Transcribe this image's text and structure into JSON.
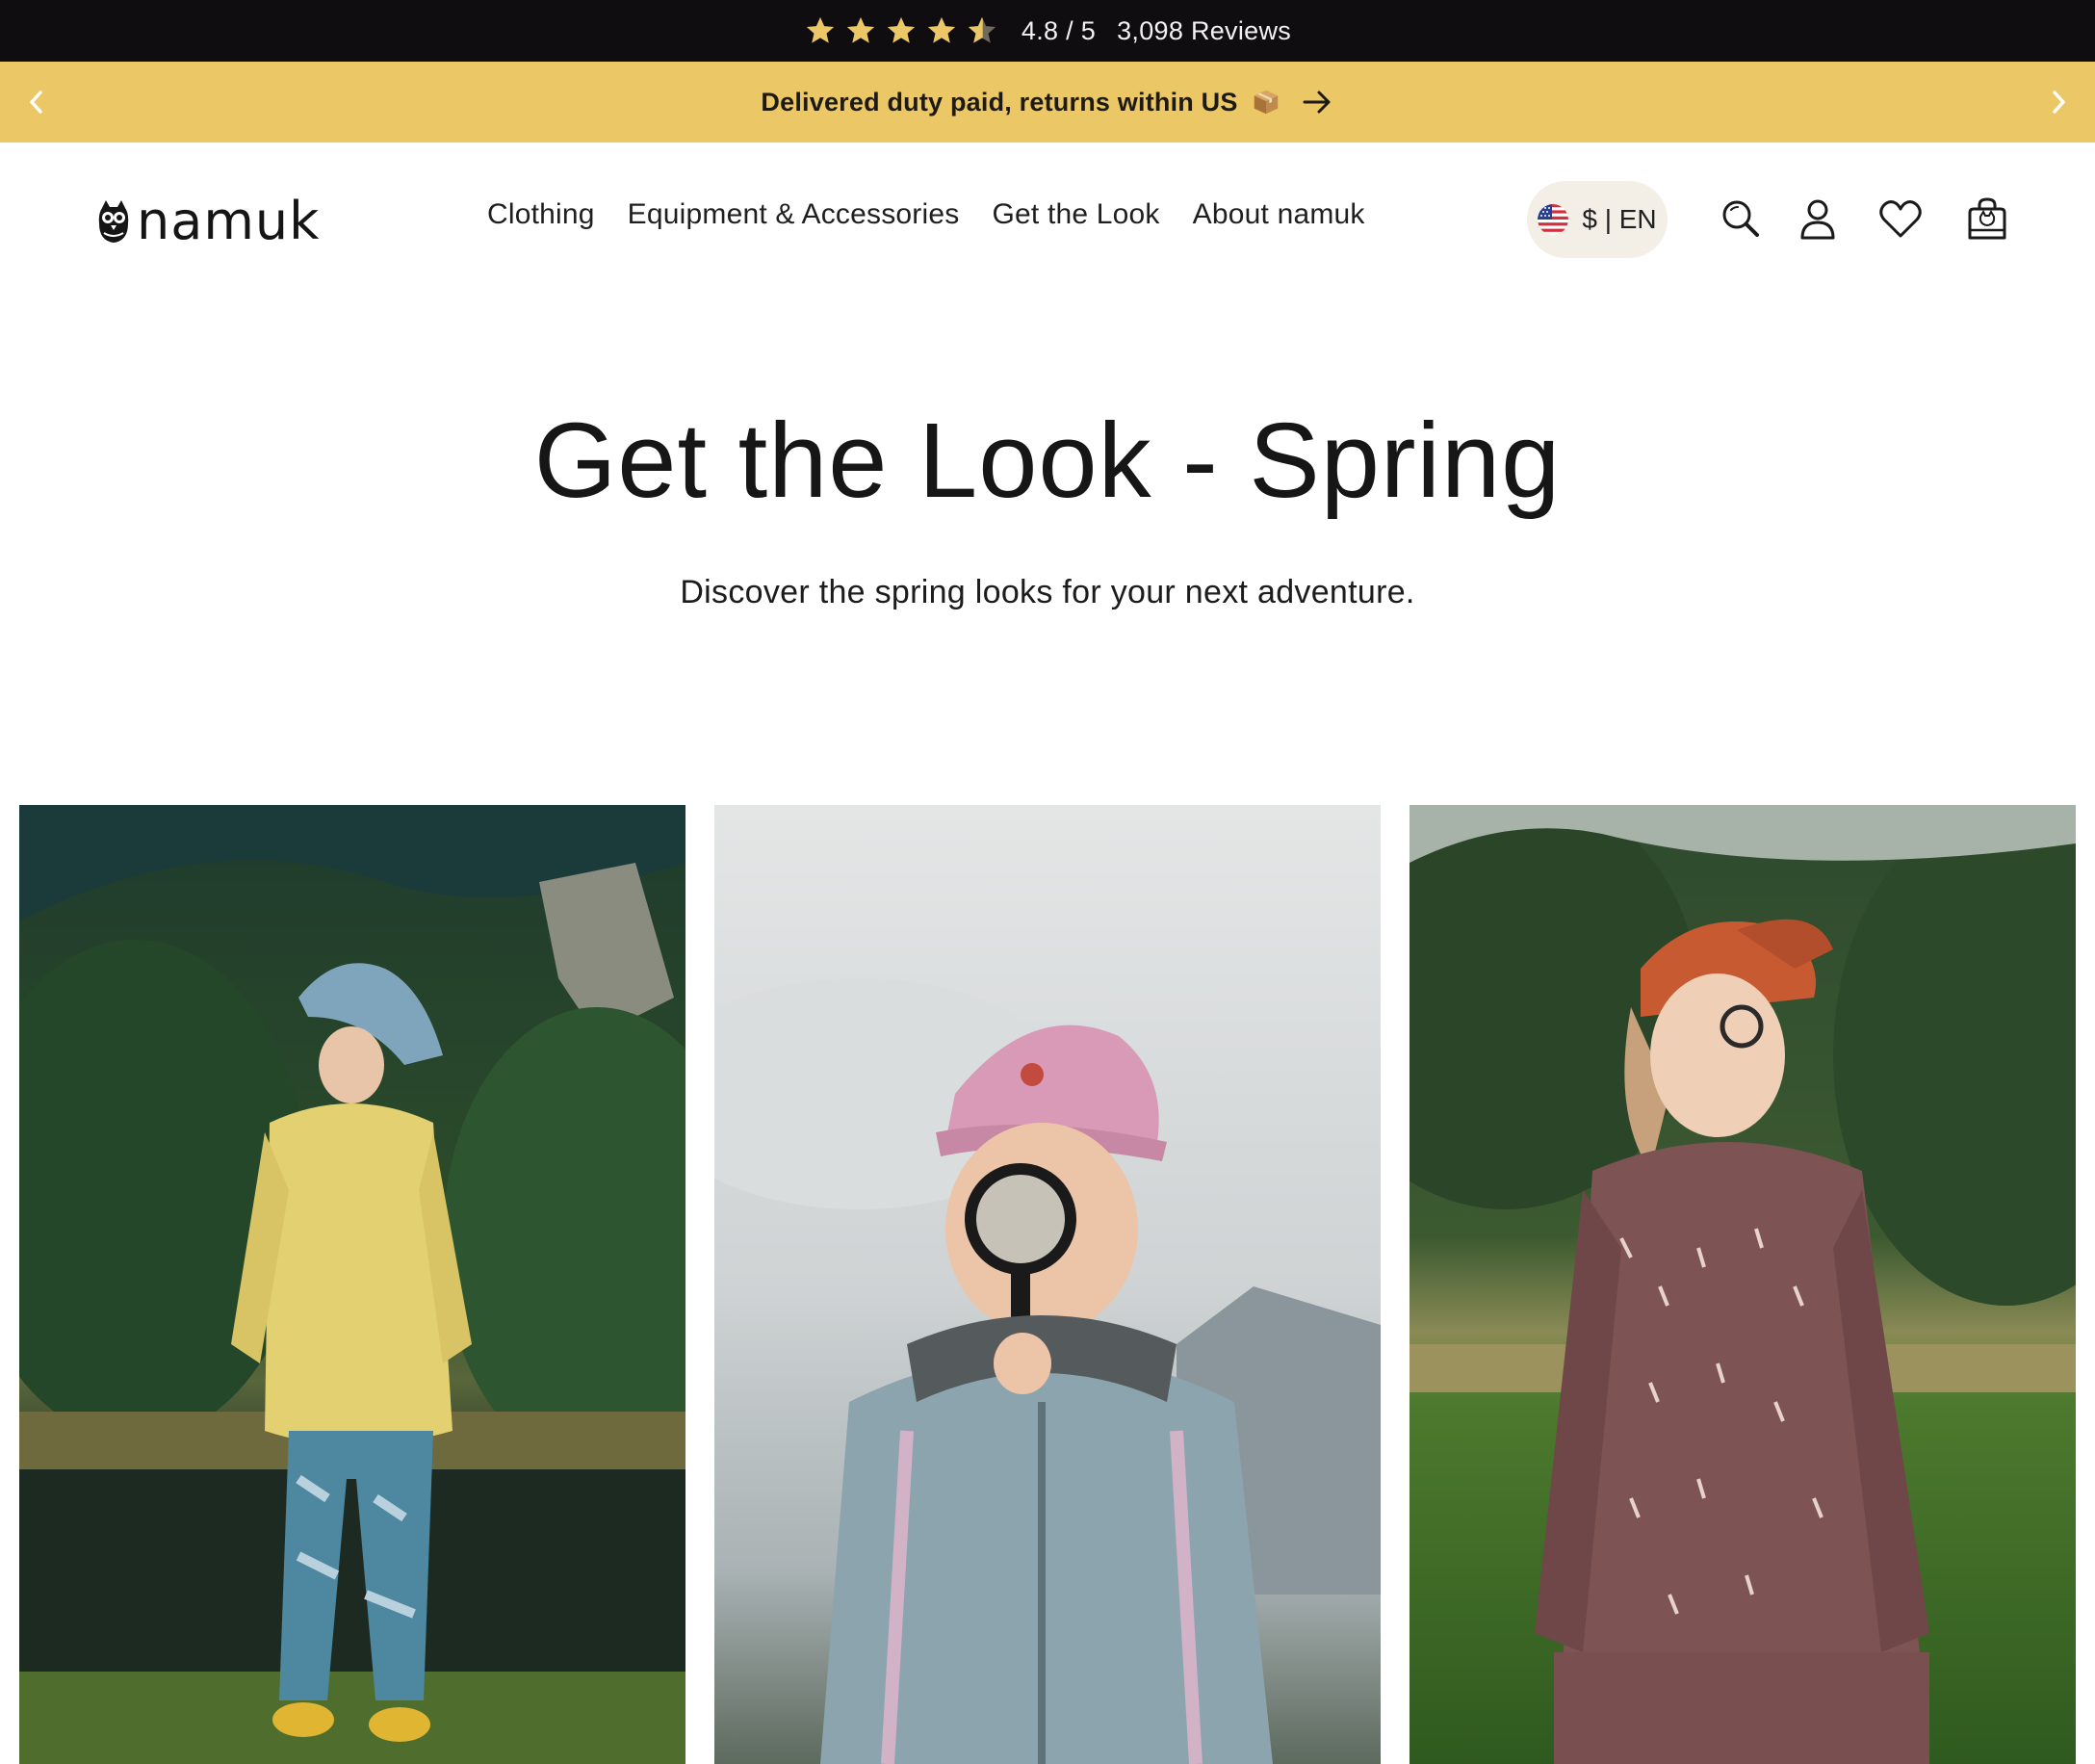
{
  "review_bar": {
    "stars": 4.5,
    "rating_text": "4.8 / 5",
    "reviews_text": "3,098 Reviews",
    "star_color": "#ecc766"
  },
  "announcement": {
    "text": "Delivered duty paid, returns within US",
    "emoji": "package-emoji",
    "background": "#ecc766"
  },
  "header": {
    "logo_text": "namuk",
    "nav": [
      "Clothing",
      "Equipment & Accessories",
      "Get the Look",
      "About namuk"
    ],
    "locale": "$ | EN",
    "icons": [
      "search-icon",
      "account-icon",
      "wishlist-icon",
      "cart-icon"
    ]
  },
  "hero": {
    "title": "Get the Look - Spring",
    "subtitle": "Discover the spring looks for your next adventure."
  },
  "looks": [
    {
      "image": "look-photo-yellow-jacket"
    },
    {
      "image": "look-photo-magnifying-glass"
    },
    {
      "image": "look-photo-red-cap"
    }
  ]
}
